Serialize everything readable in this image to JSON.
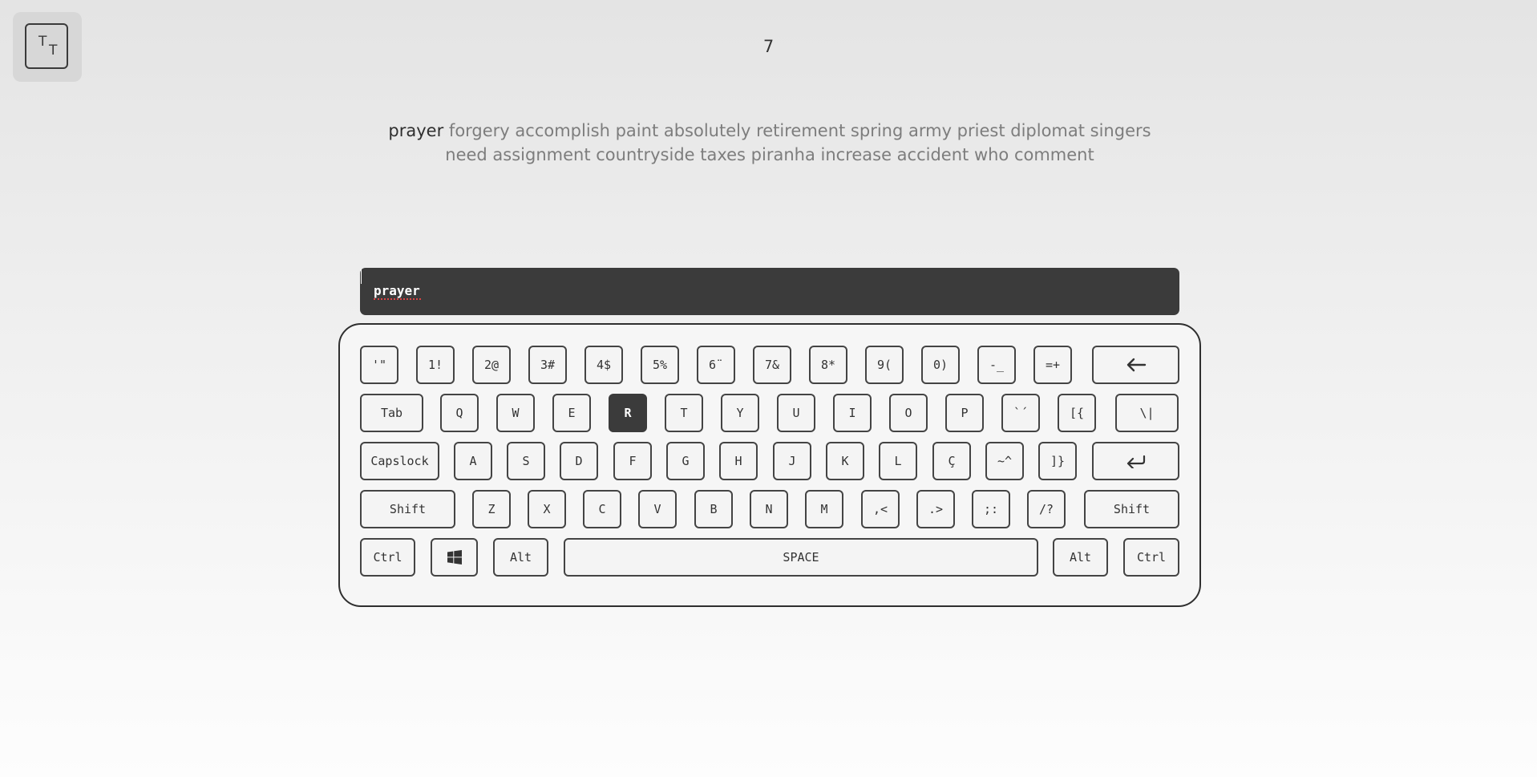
{
  "header": {
    "logo": {
      "letter1": "T",
      "letter2": "T"
    },
    "counter": "7"
  },
  "words": {
    "current": "prayer",
    "upcoming": "forgery accomplish paint absolutely retirement spring army priest diplomat singers need assignment countryside taxes piranha increase accident who comment"
  },
  "input": {
    "value": "prayer"
  },
  "keyboard": {
    "active_key": "R",
    "row1": [
      "'\"",
      "1!",
      "2@",
      "3#",
      "4$",
      "5%",
      "6¨",
      "7&",
      "8*",
      "9(",
      "0)",
      "-_",
      "=+"
    ],
    "row1_backspace_icon": "arrow-left-icon",
    "row2_tab": "Tab",
    "row2": [
      "Q",
      "W",
      "E",
      "R",
      "T",
      "Y",
      "U",
      "I",
      "O",
      "P",
      "`´",
      "[{",
      "\\|"
    ],
    "row3_capslock": "Capslock",
    "row3": [
      "A",
      "S",
      "D",
      "F",
      "G",
      "H",
      "J",
      "K",
      "L",
      "Ç",
      "~^",
      "]}"
    ],
    "row3_enter_icon": "enter-return-icon",
    "row4_shift_left": "Shift",
    "row4": [
      "Z",
      "X",
      "C",
      "V",
      "B",
      "N",
      "M",
      ",<",
      ".>",
      ";:",
      "/?"
    ],
    "row4_shift_right": "Shift",
    "row5": {
      "ctrl_left": "Ctrl",
      "win_icon": "windows-icon",
      "alt_left": "Alt",
      "space": "SPACE",
      "alt_right": "Alt",
      "ctrl_right": "Ctrl"
    }
  }
}
